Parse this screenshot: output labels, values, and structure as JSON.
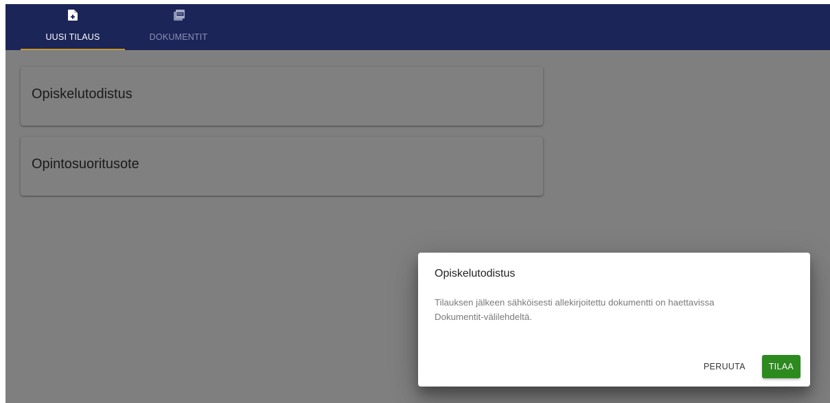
{
  "tabs": [
    {
      "label": "UUSI TILAUS",
      "icon": "file-plus-icon",
      "active": true
    },
    {
      "label": "DOKUMENTIT",
      "icon": "pdf-documents-icon",
      "active": false
    }
  ],
  "cards": [
    {
      "title": "Opiskelutodistus"
    },
    {
      "title": "Opintosuoritusote"
    }
  ],
  "dialog": {
    "title": "Opiskelutodistus",
    "line1": "Tilauksen jälkeen sähköisesti allekirjoitettu dokumentti on haettavissa",
    "line2": "Dokumentit-välilehdeltä.",
    "cancel_label": "PERUUTA",
    "confirm_label": "TILAA"
  },
  "colors": {
    "header": "#1b2558",
    "active_tab_indicator": "#c6982d",
    "overlay_background": "#7f7f7f",
    "confirm_button": "#2c8a1f"
  }
}
